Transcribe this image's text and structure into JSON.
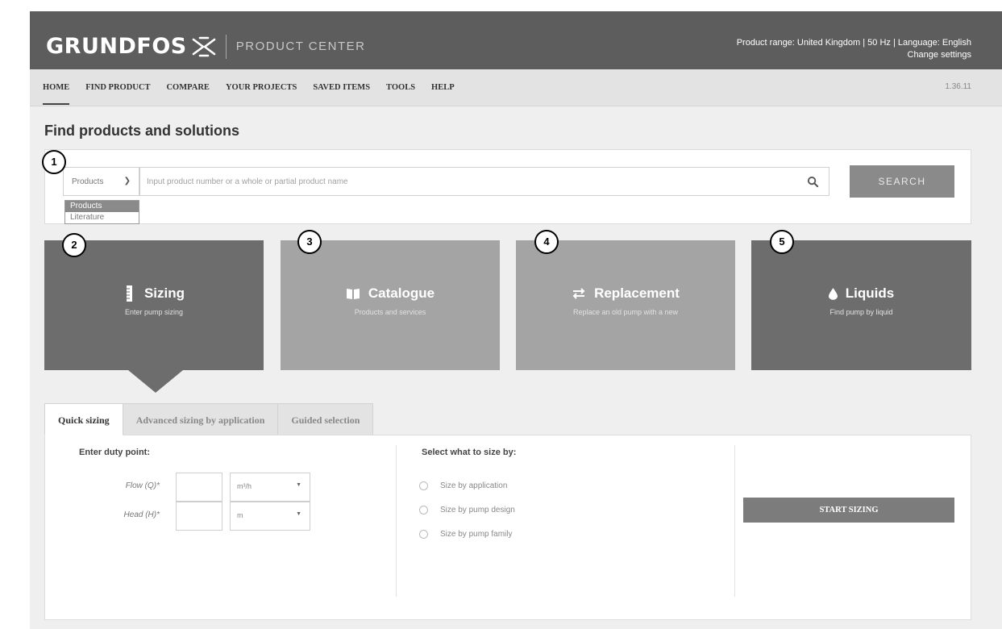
{
  "header": {
    "brand": "GRUNDFOS",
    "product_center": "PRODUCT CENTER",
    "range_line": "Product range: United Kingdom | 50 Hz | Language: English",
    "change_settings": "Change settings"
  },
  "nav": {
    "items": [
      "HOME",
      "FIND PRODUCT",
      "COMPARE",
      "YOUR PROJECTS",
      "SAVED ITEMS",
      "TOOLS",
      "HELP"
    ],
    "active": "HOME",
    "version": "1.36.11"
  },
  "page": {
    "title": "Find products and solutions"
  },
  "search": {
    "type_selected": "Products",
    "dropdown_options": [
      "Products",
      "Literature"
    ],
    "placeholder": "Input product number or a whole or partial product name",
    "button": "SEARCH"
  },
  "tiles": [
    {
      "title": "Sizing",
      "subtitle": "Enter pump sizing",
      "icon": "ruler-icon"
    },
    {
      "title": "Catalogue",
      "subtitle": "Products and services",
      "icon": "book-icon"
    },
    {
      "title": "Replacement",
      "subtitle": "Replace an old pump with a new",
      "icon": "swap-arrows-icon"
    },
    {
      "title": "Liquids",
      "subtitle": "Find pump by liquid",
      "icon": "droplet-icon"
    }
  ],
  "callouts": [
    "1",
    "2",
    "3",
    "4",
    "5"
  ],
  "tabs": [
    "Quick sizing",
    "Advanced sizing by application",
    "Guided selection"
  ],
  "quick_sizing": {
    "duty_point_heading": "Enter duty point:",
    "flow_label": "Flow (Q)*",
    "flow_unit": "m³/h",
    "head_label": "Head (H)*",
    "head_unit": "m",
    "size_by_heading": "Select what to size by:",
    "options": [
      "Size by application",
      "Size by pump design",
      "Size by pump family"
    ],
    "start_button": "START SIZING"
  },
  "colors": {
    "header_bg": "#5d5d5d",
    "tile_dark": "#6d6d6d",
    "tile_light": "#a4a4a4",
    "button_gray": "#8a8a8a"
  }
}
